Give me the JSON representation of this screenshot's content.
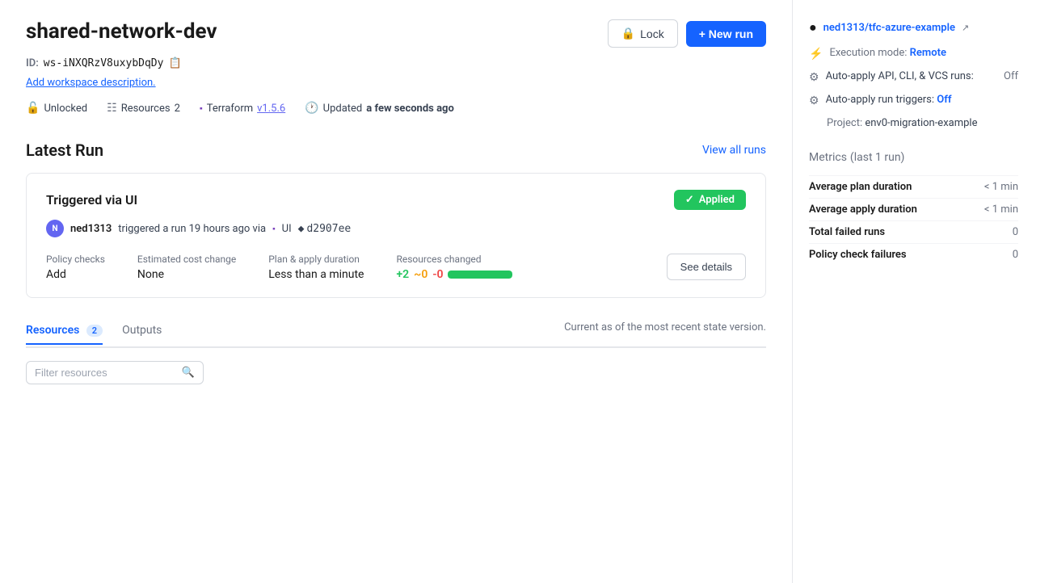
{
  "workspace": {
    "name": "shared-network-dev",
    "id_label": "ID:",
    "id_value": "ws-iNXQRzV8uxybDqDy",
    "add_description": "Add workspace description.",
    "unlocked_label": "Unlocked",
    "resources_label": "Resources",
    "resources_count": "2",
    "terraform_label": "Terraform",
    "terraform_version": "v1.5.6",
    "updated_label": "Updated",
    "updated_time": "a few seconds ago"
  },
  "header": {
    "lock_button": "Lock",
    "new_run_button": "+ New run"
  },
  "latest_run": {
    "section_title": "Latest Run",
    "view_all": "View all runs",
    "trigger_title": "Triggered via UI",
    "status_badge": "Applied",
    "trigger_user": "ned1313",
    "trigger_text": "triggered a run 19 hours ago via",
    "trigger_via": "UI",
    "commit_hash": "d2907ee",
    "policy_checks_label": "Policy checks",
    "policy_checks_value": "Add",
    "cost_change_label": "Estimated cost change",
    "cost_change_value": "None",
    "duration_label": "Plan & apply duration",
    "duration_value": "Less than a minute",
    "resources_changed_label": "Resources changed",
    "delta_add": "+2",
    "delta_change": "~0",
    "delta_remove": "-0",
    "see_details_button": "See details"
  },
  "tabs": {
    "resources_label": "Resources",
    "resources_count": "2",
    "outputs_label": "Outputs",
    "current_state_text": "Current as of the most recent state version."
  },
  "filter": {
    "placeholder": "Filter resources"
  },
  "sidebar": {
    "repo_name": "ned1313/tfc-azure-example",
    "execution_mode_label": "Execution mode:",
    "execution_mode_value": "Remote",
    "auto_apply_label": "Auto-apply API, CLI, & VCS runs:",
    "auto_apply_value": "Off",
    "auto_apply_triggers_label": "Auto-apply run triggers:",
    "auto_apply_triggers_value": "Off",
    "project_label": "Project:",
    "project_value": "env0-migration-example"
  },
  "metrics": {
    "title": "Metrics",
    "subtitle": "(last 1 run)",
    "avg_plan_label": "Average plan duration",
    "avg_plan_value": "< 1 min",
    "avg_apply_label": "Average apply duration",
    "avg_apply_value": "< 1 min",
    "failed_runs_label": "Total failed runs",
    "failed_runs_value": "0",
    "policy_failures_label": "Policy check failures",
    "policy_failures_value": "0"
  }
}
